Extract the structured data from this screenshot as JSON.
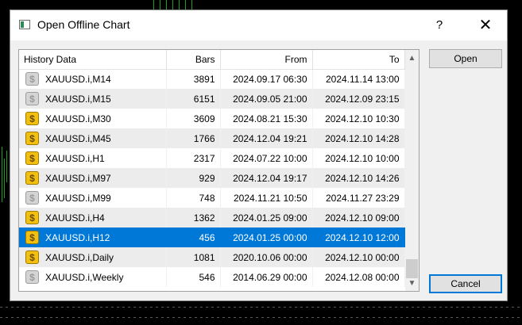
{
  "dialog": {
    "title": "Open Offline Chart",
    "help_label": "?",
    "close_label": "✕"
  },
  "table": {
    "headers": {
      "name": "History Data",
      "bars": "Bars",
      "from": "From",
      "to": "To"
    },
    "rows": [
      {
        "name": "XAUUSD.i,M14",
        "bars": "3891",
        "from": "2024.09.17 06:30",
        "to": "2024.11.14 13:00",
        "icon": "gray",
        "selected": false
      },
      {
        "name": "XAUUSD.i,M15",
        "bars": "6151",
        "from": "2024.09.05 21:00",
        "to": "2024.12.09 23:15",
        "icon": "gray",
        "selected": false
      },
      {
        "name": "XAUUSD.i,M30",
        "bars": "3609",
        "from": "2024.08.21 15:30",
        "to": "2024.12.10 10:30",
        "icon": "gold",
        "selected": false
      },
      {
        "name": "XAUUSD.i,M45",
        "bars": "1766",
        "from": "2024.12.04 19:21",
        "to": "2024.12.10 14:28",
        "icon": "gold",
        "selected": false
      },
      {
        "name": "XAUUSD.i,H1",
        "bars": "2317",
        "from": "2024.07.22 10:00",
        "to": "2024.12.10 10:00",
        "icon": "gold",
        "selected": false
      },
      {
        "name": "XAUUSD.i,M97",
        "bars": "929",
        "from": "2024.12.04 19:17",
        "to": "2024.12.10 14:26",
        "icon": "gold",
        "selected": false
      },
      {
        "name": "XAUUSD.i,M99",
        "bars": "748",
        "from": "2024.11.21 10:50",
        "to": "2024.11.27 23:29",
        "icon": "gray",
        "selected": false
      },
      {
        "name": "XAUUSD.i,H4",
        "bars": "1362",
        "from": "2024.01.25 09:00",
        "to": "2024.12.10 09:00",
        "icon": "gold",
        "selected": false
      },
      {
        "name": "XAUUSD.i,H12",
        "bars": "456",
        "from": "2024.01.25 00:00",
        "to": "2024.12.10 12:00",
        "icon": "gold",
        "selected": true
      },
      {
        "name": "XAUUSD.i,Daily",
        "bars": "1081",
        "from": "2020.10.06 00:00",
        "to": "2024.12.10 00:00",
        "icon": "gold",
        "selected": false
      },
      {
        "name": "XAUUSD.i,Weekly",
        "bars": "546",
        "from": "2014.06.29 00:00",
        "to": "2024.12.08 00:00",
        "icon": "gray",
        "selected": false
      }
    ]
  },
  "buttons": {
    "open": "Open",
    "cancel": "Cancel"
  },
  "colors": {
    "selection": "#0078d7",
    "chart_background": "#000000",
    "chart_bars": "#1e9e1e"
  }
}
